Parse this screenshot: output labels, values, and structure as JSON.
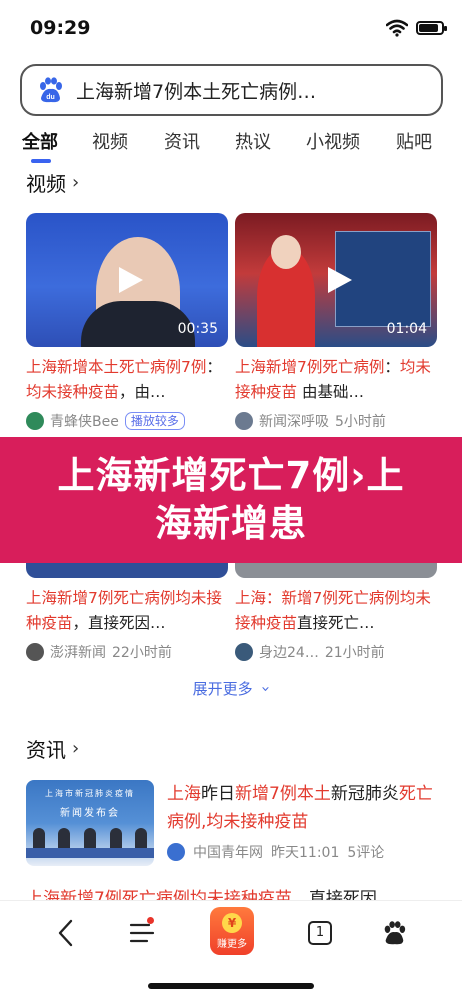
{
  "status": {
    "time": "09:29"
  },
  "search": {
    "query": "上海新增7例本土死亡病例…"
  },
  "tabs": [
    "全部",
    "视频",
    "资讯",
    "热议",
    "小视频",
    "贴吧"
  ],
  "video_section": {
    "title": "视频"
  },
  "videos": [
    {
      "duration": "00:35",
      "title_hl1": "上海新增本土死亡病例7例",
      "title_mid": "：",
      "title_hl2": "均未接种疫苗",
      "title_end": "，由…",
      "source": "青蜂侠Bee",
      "badge": "播放较多",
      "time": ""
    },
    {
      "duration": "01:04",
      "title_hl1": "上海新增7例死亡病例",
      "title_mid": "：",
      "title_hl2": "均未接种疫苗",
      "title_end": " 由基础…",
      "source": "新闻深呼吸",
      "badge": "",
      "time": "5小时前"
    },
    {
      "title_hl1": "上海新增7例死亡病例均未接种疫苗",
      "title_end": "，直接死因…",
      "source": "澎湃新闻",
      "time": "22小时前"
    },
    {
      "title_pre": "上海：",
      "title_hl1": "新增7例死亡病例",
      "title_hl2": "均未接种疫苗",
      "title_end": "直接死亡…",
      "source": "身边24…",
      "time": "21小时前"
    }
  ],
  "overlay": {
    "text": "上海新增死亡7例›上海新增患"
  },
  "expand_label": "展开更多",
  "news_section": {
    "title": "资讯"
  },
  "news": {
    "thumb_text": "上海市新冠肺炎疫情",
    "thumb_text2": "新闻发布会",
    "title_hl1": "上海",
    "title_p1": "昨日",
    "title_hl2": "新增7例本土",
    "title_p2": "新冠肺炎",
    "title_hl3": "死亡病例,均未接种疫苗",
    "source": "中国青年网",
    "time": "昨天11:01",
    "comments": "5评论",
    "next_hl": "上海新增7例死亡病例均未接种疫苗",
    "next_end": "，直接死因"
  },
  "bottom_bar": {
    "earn_label": "赚更多",
    "earn_coin": "¥",
    "tabs_count": "1"
  }
}
